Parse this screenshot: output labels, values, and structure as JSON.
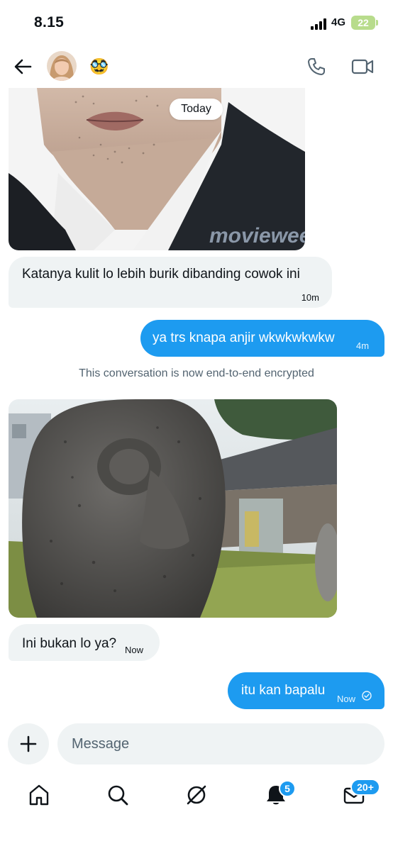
{
  "status_bar": {
    "time": "8.15",
    "network": "4G",
    "battery": "22"
  },
  "header": {
    "emoji": "🥸",
    "icons": [
      "back-arrow-icon",
      "phone-icon",
      "video-camera-icon"
    ]
  },
  "conversation": {
    "date_separator": "Today",
    "image_watermark": "movieweek",
    "system_message": "This conversation is now end-to-end encrypted",
    "messages": [
      {
        "direction": "incoming",
        "text": "Katanya kulit lo lebih burik dibanding cowok ini",
        "time": "10m"
      },
      {
        "direction": "outgoing",
        "text": "ya trs knapa anjir wkwkwkwkw",
        "time": "4m"
      },
      {
        "direction": "incoming",
        "text": "Ini bukan lo ya?",
        "time": "Now"
      },
      {
        "direction": "outgoing",
        "text": "itu kan bapalu",
        "time": "Now",
        "status": "seen-check-icon"
      }
    ]
  },
  "composer": {
    "placeholder": "Message"
  },
  "tab_bar": {
    "notifications_badge": "5",
    "messages_badge": "20+"
  },
  "colors": {
    "accent": "#1d9bf0",
    "incoming_bubble": "#eff3f4",
    "battery": "#b8dc8c"
  }
}
